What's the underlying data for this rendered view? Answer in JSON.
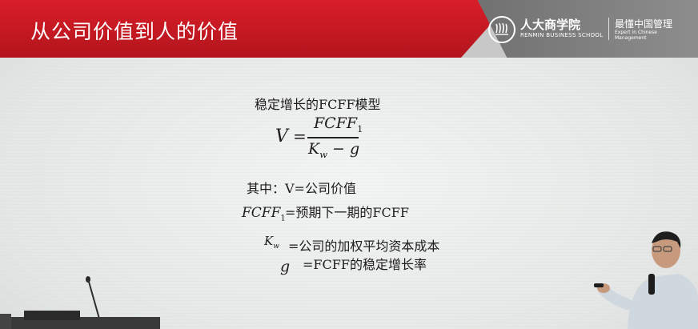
{
  "header": {
    "title": "从公司价值到人的价值",
    "school_name": "人大商学院",
    "school_name_en": "RENMIN BUSINESS SCHOOL",
    "slogan": "最懂中国管理",
    "slogan_en": "Expert in Chinese Management"
  },
  "content": {
    "model_title": "稳定增长的FCFF模型",
    "formula": {
      "lhs": "V",
      "equals": "=",
      "numerator": "FCFF",
      "numerator_sub": "1",
      "denominator_k": "K",
      "denominator_k_sub": "w",
      "denominator_rest": " − g"
    },
    "where_line": "其中：V=公司价值",
    "def1_symbol": "FCFF",
    "def1_symbol_sub": "1",
    "def1_text": "=预期下一期的FCFF",
    "def2_symbol": "K",
    "def2_symbol_sub": "w",
    "def2_text": "=公司的加权平均资本成本",
    "def3_symbol": "g",
    "def3_text": "=FCFF的稳定增长率"
  },
  "colors": {
    "banner_red": "#c81a22",
    "banner_grey": "#7a7a7a"
  }
}
